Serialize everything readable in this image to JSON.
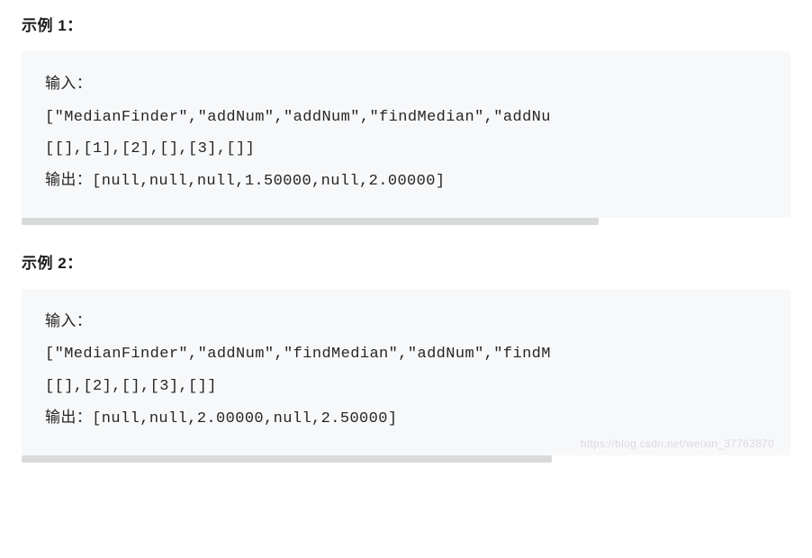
{
  "examples": [
    {
      "label": "示例 1：",
      "input_label": "输入：",
      "input_ops": "[\"MedianFinder\",\"addNum\",\"addNum\",\"findMedian\",\"addNu",
      "input_args": "[[],[1],[2],[],[3],[]]",
      "output_label": "输出：",
      "output_value": "[null,null,null,1.50000,null,2.00000]",
      "scroll_width": "75%"
    },
    {
      "label": "示例 2：",
      "input_label": "输入：",
      "input_ops": "[\"MedianFinder\",\"addNum\",\"findMedian\",\"addNum\",\"findM",
      "input_args": "[[],[2],[],[3],[]]",
      "output_label": "输出：",
      "output_value": "[null,null,2.00000,null,2.50000]",
      "scroll_width": "69%"
    }
  ],
  "watermark": "https://blog.csdn.net/weixin_37763870"
}
